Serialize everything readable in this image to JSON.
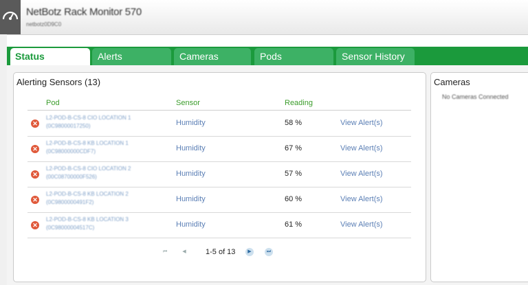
{
  "header": {
    "title": "NetBotz Rack Monitor 570",
    "subtitle": "netbotz0D9C0"
  },
  "tabs": [
    {
      "label": "Status",
      "active": true
    },
    {
      "label": "Alerts",
      "active": false
    },
    {
      "label": "Cameras",
      "active": false
    },
    {
      "label": "Pods",
      "active": false
    },
    {
      "label": "Sensor History",
      "active": false
    }
  ],
  "alerting": {
    "title": "Alerting Sensors (13)",
    "columns": {
      "pod": "Pod",
      "sensor": "Sensor",
      "reading": "Reading"
    },
    "rows": [
      {
        "pod_line1": "L2-POD-B-CS-8 CIO LOCATION 1",
        "pod_line2": "(0C98000017250)",
        "sensor": "Humidity",
        "reading": "58 %",
        "action": "View Alert(s)"
      },
      {
        "pod_line1": "L2-POD-B-CS-8 KB LOCATION 1",
        "pod_line2": "(0C98000000CDF7)",
        "sensor": "Humidity",
        "reading": "67 %",
        "action": "View Alert(s)"
      },
      {
        "pod_line1": "L2-POD-B-CS-8 CIO LOCATION 2",
        "pod_line2": "(00C08700000F526)",
        "sensor": "Humidity",
        "reading": "57 %",
        "action": "View Alert(s)"
      },
      {
        "pod_line1": "L2-POD-B-CS-8 KB LOCATION 2",
        "pod_line2": "(0C9800000491F2)",
        "sensor": "Humidity",
        "reading": "60 %",
        "action": "View Alert(s)"
      },
      {
        "pod_line1": "L2-POD-B-CS-8 KB LOCATION 3",
        "pod_line2": "(0C98000004517C)",
        "sensor": "Humidity",
        "reading": "61 %",
        "action": "View Alert(s)"
      }
    ],
    "pager": {
      "text": "1-5 of 13",
      "first": "⏮",
      "prev": "◀",
      "next": "▶",
      "last": "⏭"
    }
  },
  "cameras": {
    "title": "Cameras",
    "empty_text": "No Cameras Connected"
  },
  "colors": {
    "tab_bar": "#1b9a3c",
    "tab_inactive": "#3db165",
    "alert": "#e0593a",
    "link": "#5b7fb5"
  }
}
